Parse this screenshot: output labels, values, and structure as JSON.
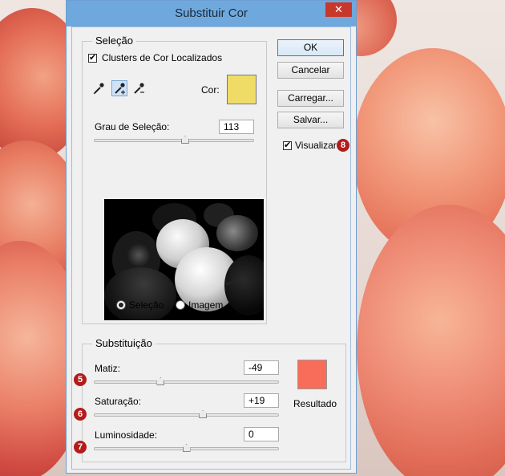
{
  "window": {
    "title": "Substituir Cor",
    "close_glyph": "✕"
  },
  "selection": {
    "legend": "Seleção",
    "clusters_label": "Clusters de Cor Localizados",
    "clusters_checked": true,
    "color_label": "Cor:",
    "color_swatch": "#efdc67",
    "fuzziness_label": "Grau de Seleção:",
    "fuzziness_value": "113",
    "fuzziness_level": 0.57,
    "radio_selection": "Seleção",
    "radio_image": "Imagem",
    "selected_radio": "Seleção",
    "tools": [
      "eyedropper-icon",
      "eyedropper-plus-icon",
      "eyedropper-minus-icon"
    ]
  },
  "buttons": {
    "ok": "OK",
    "cancel": "Cancelar",
    "load": "Carregar...",
    "save": "Salvar..."
  },
  "preview_toggle": {
    "label": "Visualizar",
    "checked": true,
    "marker": "8"
  },
  "replacement": {
    "legend": "Substituição",
    "hue": {
      "label": "Matiz:",
      "value": "-49",
      "marker": "5",
      "level": 0.36
    },
    "saturation": {
      "label": "Saturação:",
      "value": "+19",
      "marker": "6",
      "level": 0.59
    },
    "lightness": {
      "label": "Luminosidade:",
      "value": "0",
      "marker": "7",
      "level": 0.5
    },
    "result_label": "Resultado",
    "result_swatch": "#f86d5a"
  },
  "colors": {
    "titlebar": "#6fa8dc",
    "close": "#c7372a",
    "marker": "#b51a1a"
  }
}
